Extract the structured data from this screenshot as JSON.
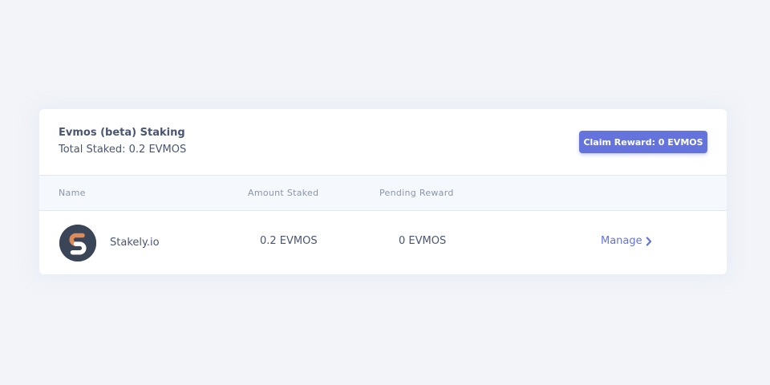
{
  "staking": {
    "title": "Evmos (beta) Staking",
    "total_staked": "Total Staked: 0.2 EVMOS",
    "claim_button": "Claim Reward: 0 EVMOS"
  },
  "table": {
    "columns": [
      "Name",
      "Amount Staked",
      "Pending Reward"
    ],
    "rows": [
      {
        "name": "Stakely.io",
        "amount_staked": "0.2 EVMOS",
        "pending_reward": "0 EVMOS",
        "action": "Manage",
        "avatar_icon": "stakely-logo-icon"
      }
    ]
  },
  "colors": {
    "accent": "#6474dc",
    "background": "#f2f4f9",
    "text": "#4a5670",
    "muted": "#8a95a8",
    "avatar_bg": "#3b4558",
    "logo_orange": "#e08a55"
  },
  "icons": {
    "manage_chevron": "chevron-right-icon"
  }
}
